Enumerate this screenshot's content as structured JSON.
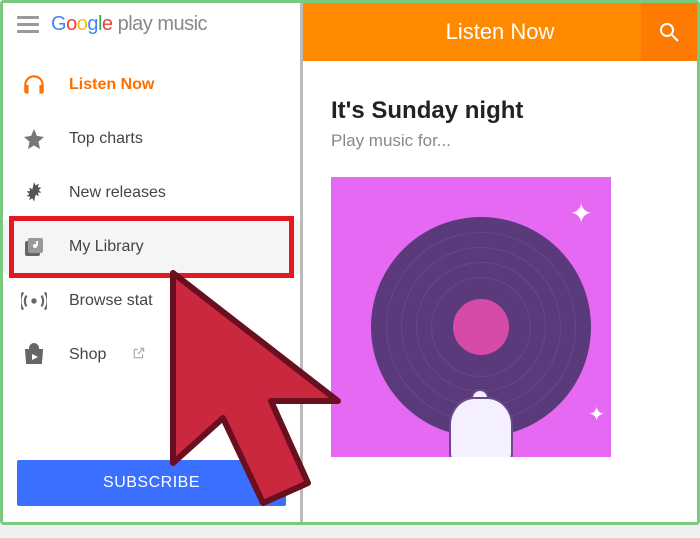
{
  "brand": {
    "google": "Google",
    "product": " play music"
  },
  "sidebar": {
    "items": [
      {
        "label": "Listen Now",
        "icon": "headphones-icon",
        "active": true
      },
      {
        "label": "Top charts",
        "icon": "star-icon",
        "active": false
      },
      {
        "label": "New releases",
        "icon": "burst-icon",
        "active": false
      },
      {
        "label": "My Library",
        "icon": "library-icon",
        "active": false,
        "highlighted": true
      },
      {
        "label": "Browse stat",
        "icon": "radio-icon",
        "active": false
      },
      {
        "label": "Shop",
        "icon": "shop-icon",
        "active": false,
        "external": true
      }
    ],
    "subscribe_label": "SUBSCRIBE"
  },
  "right": {
    "header_title": "Listen Now",
    "greeting": "It's Sunday night",
    "subgreeting": "Play music for...",
    "card_caption": ""
  },
  "colors": {
    "accent": "#ff8a00",
    "highlight": "#e5171f",
    "subscribe": "#3a6fff"
  }
}
